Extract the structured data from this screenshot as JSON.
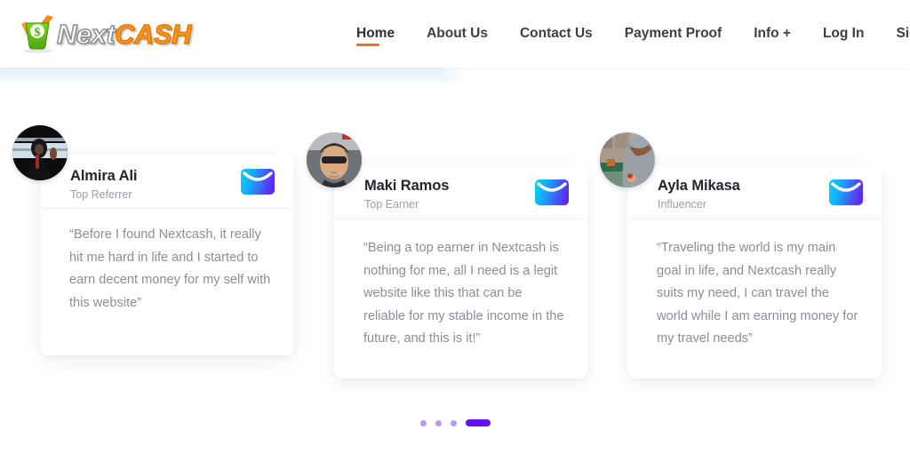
{
  "header": {
    "logo": {
      "text_primary": "Next",
      "text_secondary": "CASH",
      "mark_icon": "basket-dollar-check-icon",
      "primary_color": "#ffffff",
      "secondary_color": "#f7941e"
    },
    "nav": {
      "active_color": "#f2711c",
      "items": [
        {
          "label": "Home",
          "active": true
        },
        {
          "label": "About Us",
          "active": false
        },
        {
          "label": "Contact Us",
          "active": false
        },
        {
          "label": "Payment Proof",
          "active": false
        },
        {
          "label": "Info +",
          "active": false
        },
        {
          "label": "Log In",
          "active": false
        },
        {
          "label": "Sign Up",
          "active": false
        }
      ]
    }
  },
  "testimonials": {
    "mail_icon": "envelope-icon",
    "mail_gradient_from": "#0ad3f5",
    "mail_gradient_to": "#6c14f0",
    "cards": [
      {
        "name": "Almira Ali",
        "role": "Top Referrer",
        "quote": "“Before I found Nextcash, it really hit me hard in life and I started to earn decent money for my self with this website”",
        "avatar_icon": "avatar-photo-woman-hijab"
      },
      {
        "name": "Maki Ramos",
        "role": "Top Earner",
        "quote": "“Being a top earner in Nextcash is nothing for me, all I need is a legit website like this that can be reliable for my stable income in the future, and this is it!”",
        "avatar_icon": "avatar-photo-man-sunglasses"
      },
      {
        "name": "Ayla Mikasa",
        "role": "Influencer",
        "quote": "“Traveling the world is my main goal in life, and Nextcash really suits my need, I can travel the world while I am earning money for my travel needs”",
        "avatar_icon": "avatar-photo-traveler"
      }
    ]
  },
  "carousel": {
    "dots": [
      {
        "active": false
      },
      {
        "active": false
      },
      {
        "active": false
      },
      {
        "active": true
      }
    ],
    "dot_color": "#b49bf5",
    "active_dot_color": "#6610f2"
  }
}
